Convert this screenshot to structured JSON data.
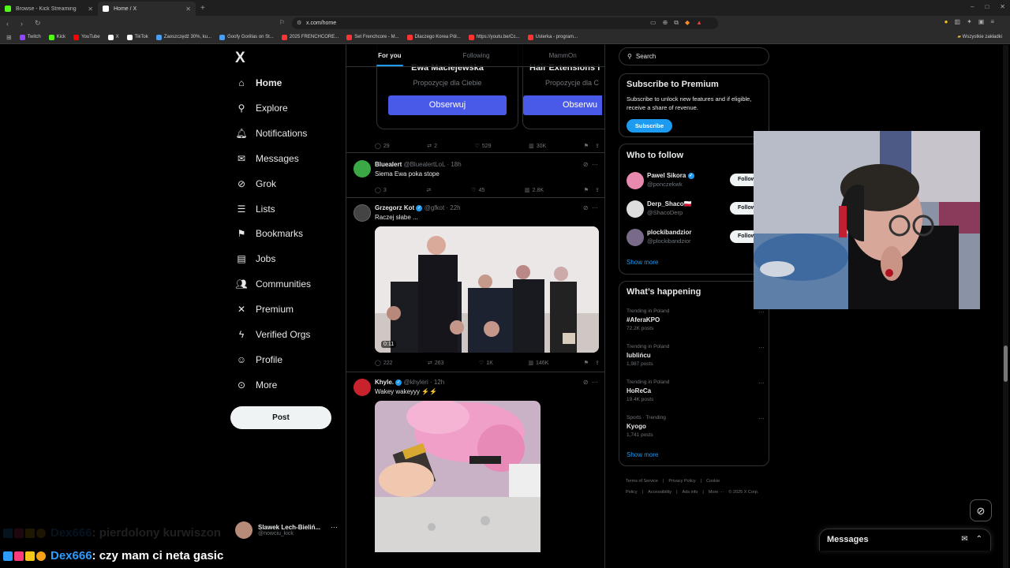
{
  "browser": {
    "tabs": [
      {
        "label": "Browse - Kick Streaming",
        "favicon_color": "#53fc18",
        "active": false
      },
      {
        "label": "Home / X",
        "favicon_color": "#ffffff",
        "active": true
      }
    ],
    "url": "x.com/home",
    "bookmarks": [
      {
        "label": "Twitch",
        "color": "#9146ff"
      },
      {
        "label": "Kick",
        "color": "#53fc18"
      },
      {
        "label": "YouTube",
        "color": "#ff0000"
      },
      {
        "label": "X",
        "color": "#ffffff"
      },
      {
        "label": "TikTok",
        "color": "#ffffff"
      },
      {
        "label": "Zaoszczędź 30%, ku...",
        "color": "#4a9df0"
      },
      {
        "label": "Goofy Gorillas on St...",
        "color": "#4a9df0"
      },
      {
        "label": "2025 FRENCHCORE...",
        "color": "#ff3333"
      },
      {
        "label": "Set Frenchcore - M...",
        "color": "#ff3333"
      },
      {
        "label": "Dlaczego Korea Pół...",
        "color": "#ff3333"
      },
      {
        "label": "https://youtu.be/Cc...",
        "color": "#ff3333"
      },
      {
        "label": "Usterka - program...",
        "color": "#ff3333"
      }
    ],
    "bookmarks_right": "Wszystkie zakładki"
  },
  "sidebar": {
    "logo": "X",
    "items": [
      {
        "label": "Home",
        "icon": "home-icon",
        "glyph": "⌂"
      },
      {
        "label": "Explore",
        "icon": "search-icon",
        "glyph": "⚲"
      },
      {
        "label": "Notifications",
        "icon": "bell-icon",
        "glyph": "🔔︎"
      },
      {
        "label": "Messages",
        "icon": "mail-icon",
        "glyph": "✉"
      },
      {
        "label": "Grok",
        "icon": "grok-icon",
        "glyph": "⊘"
      },
      {
        "label": "Lists",
        "icon": "list-icon",
        "glyph": "☰"
      },
      {
        "label": "Bookmarks",
        "icon": "bookmark-icon",
        "glyph": "⚑"
      },
      {
        "label": "Jobs",
        "icon": "briefcase-icon",
        "glyph": "▤"
      },
      {
        "label": "Communities",
        "icon": "communities-icon",
        "glyph": "👥︎"
      },
      {
        "label": "Premium",
        "icon": "x-premium-icon",
        "glyph": "✕"
      },
      {
        "label": "Verified Orgs",
        "icon": "lightning-icon",
        "glyph": "ϟ"
      },
      {
        "label": "Profile",
        "icon": "person-icon",
        "glyph": "☺"
      },
      {
        "label": "More",
        "icon": "more-circle-icon",
        "glyph": "⊙"
      }
    ],
    "post_label": "Post",
    "account": {
      "name": "Slawek Lech-Bieliń...",
      "handle": "@nowciu_kick"
    }
  },
  "feed": {
    "tabs": [
      "For you",
      "Following",
      "MammOn"
    ],
    "suggestion_cards": [
      {
        "name": "Ewa Maciejewska",
        "sub": "Propozycje dla Ciebie",
        "button": "Obserwuj"
      },
      {
        "name": "Hair Extensions I",
        "sub": "Propozycje dla C",
        "button": "Obserwu"
      }
    ],
    "card_actions": {
      "replies": "29",
      "reposts": "2",
      "likes": "529",
      "views": "30K"
    },
    "tweets": [
      {
        "name": "Bluealert",
        "handle": "@BluealertLoL · 18h",
        "text": "Siema Ewa poka stope",
        "verified": false,
        "replies": "3",
        "reposts": "",
        "likes": "45",
        "views": "2.8K"
      },
      {
        "name": "Grzegorz Kot",
        "handle": "@gfkot · 22h",
        "text": "Raczej słabe ...",
        "verified": true,
        "video_time": "0:11",
        "replies": "222",
        "reposts": "263",
        "likes": "1K",
        "views": "146K"
      },
      {
        "name": "Khyle.",
        "handle": "@khyleri · 12h",
        "text": "Wakey wakeyyy ⚡⚡",
        "verified": true
      }
    ]
  },
  "right": {
    "search_placeholder": "Search",
    "premium": {
      "title": "Subscribe to Premium",
      "text": "Subscribe to unlock new features and if eligible, receive a share of revenue.",
      "button": "Subscribe"
    },
    "who_to_follow": {
      "title": "Who to follow",
      "users": [
        {
          "name": "Pawel Sikora",
          "handle": "@ponczekwk",
          "verified": true,
          "flag": "",
          "color": "#e88ab0"
        },
        {
          "name": "Derp_Shaco",
          "handle": "@ShacoDerp",
          "verified": false,
          "flag": "🇵🇱",
          "color": "#cccccc"
        },
        {
          "name": "plockibandzior",
          "handle": "@plockibandzior",
          "verified": false,
          "flag": "",
          "color": "#7a6a8a"
        }
      ],
      "follow_label": "Follow",
      "show_more": "Show more"
    },
    "happening": {
      "title": "What’s happening",
      "trends": [
        {
          "context": "Trending in Poland",
          "name": "#AferaKPO",
          "posts": "72.2K posts"
        },
        {
          "context": "Trending in Poland",
          "name": "lublińcu",
          "posts": "1,987 posts"
        },
        {
          "context": "Trending in Poland",
          "name": "HoReCa",
          "posts": "19.4K posts"
        },
        {
          "context": "Sports · Trending",
          "name": "Kyogo",
          "posts": "1,741 posts"
        }
      ],
      "show_more": "Show more"
    },
    "footer": [
      "Terms of Service",
      "|",
      "Privacy Policy",
      "|",
      "Cookie Policy",
      "|",
      "Accessibility",
      "|",
      "Ads info",
      "|",
      "More ···",
      "© 2025 X Corp."
    ]
  },
  "messages_dock": {
    "label": "Messages"
  },
  "chat": [
    {
      "user": "Dex666",
      "message": ": pierdolony kurwiszon",
      "faded": true
    },
    {
      "user": "Dex666",
      "message": ": czy mam ci neta gasic",
      "faded": false
    }
  ]
}
